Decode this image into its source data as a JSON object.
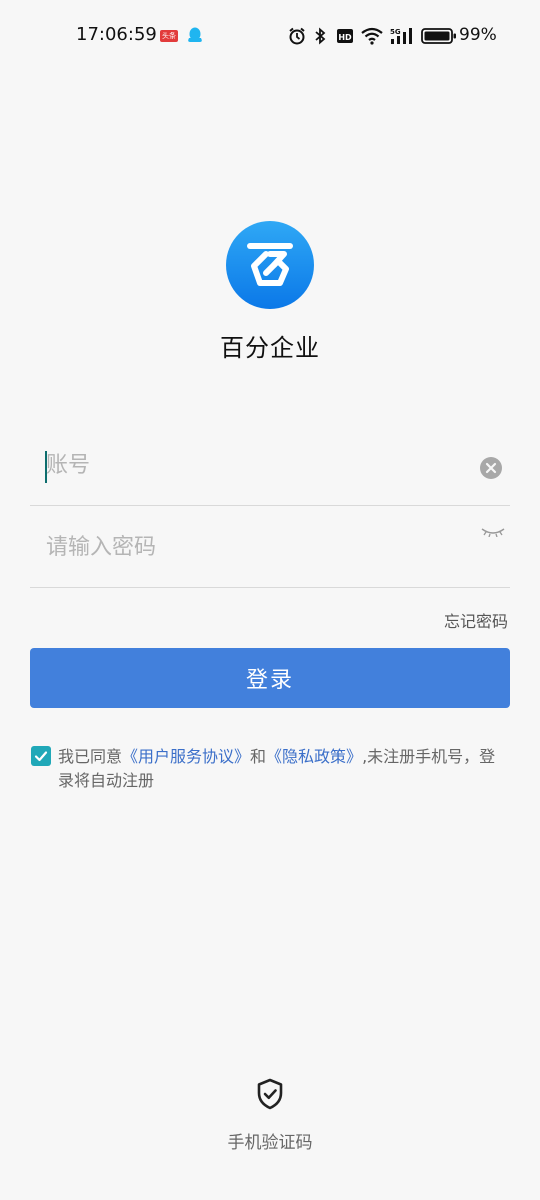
{
  "status_bar": {
    "time": "17:06:59",
    "toutiao_badge": "头条",
    "battery": "99%",
    "icons": [
      "alarm-icon",
      "bluetooth-icon",
      "hd-icon",
      "wifi-icon",
      "signal-5g-icon",
      "battery-icon"
    ]
  },
  "app": {
    "name": "百分企业",
    "logo_char": "百",
    "brand_color": "#1c8df0"
  },
  "login_form": {
    "account_placeholder": "账号",
    "account_value": "",
    "password_placeholder": "请输入密码",
    "password_value": "",
    "forgot_password": "忘记密码",
    "login_button": "登录"
  },
  "agreement": {
    "checked": true,
    "prefix": "我已同意",
    "user_agreement": "《用户服务协议》",
    "and": "和",
    "privacy_policy": "《隐私政策》",
    "suffix": ",未注册手机号，登录将自动注册"
  },
  "alt_login": {
    "label": "手机验证码"
  },
  "colors": {
    "primary_button": "#4280dc",
    "link": "#3b6fc9",
    "checkbox": "#20a8b8"
  }
}
